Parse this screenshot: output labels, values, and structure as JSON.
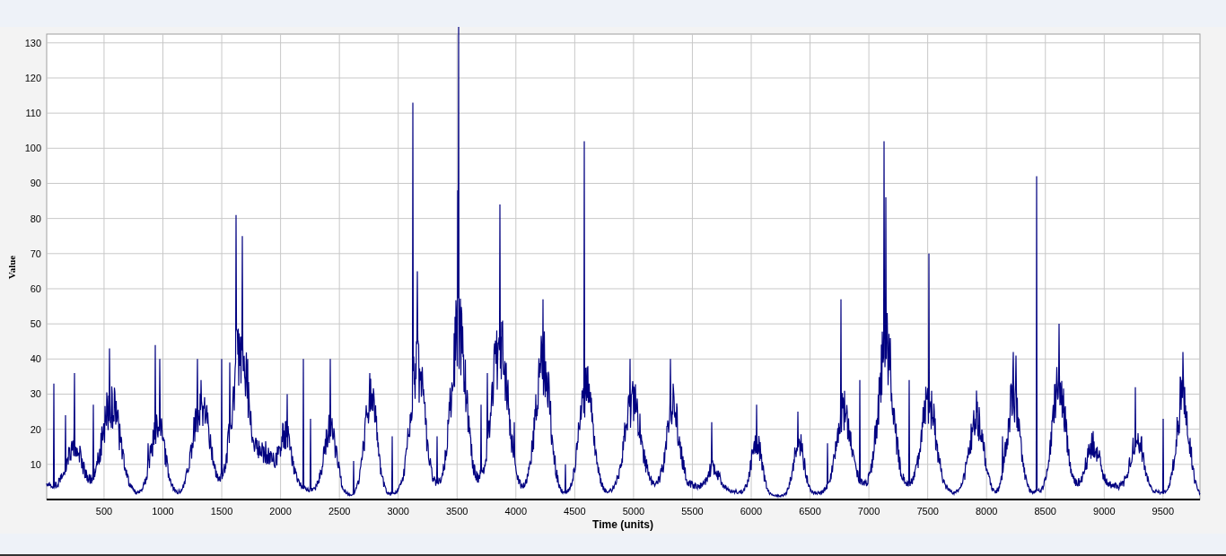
{
  "chart": {
    "ylabel": "Value",
    "xlabel": "Time (units)",
    "yticks": [
      "130",
      "120",
      "110",
      "100",
      "90",
      "80",
      "70",
      "60",
      "50",
      "40",
      "30",
      "20",
      "10"
    ],
    "xticks": [
      "500",
      "1000",
      "1500",
      "2000",
      "2500",
      "3000",
      "3500",
      "4000",
      "4500",
      "5000",
      "5500",
      "6000",
      "6500",
      "7000",
      "7500",
      "8000",
      "8500",
      "9000",
      "9500"
    ]
  }
}
